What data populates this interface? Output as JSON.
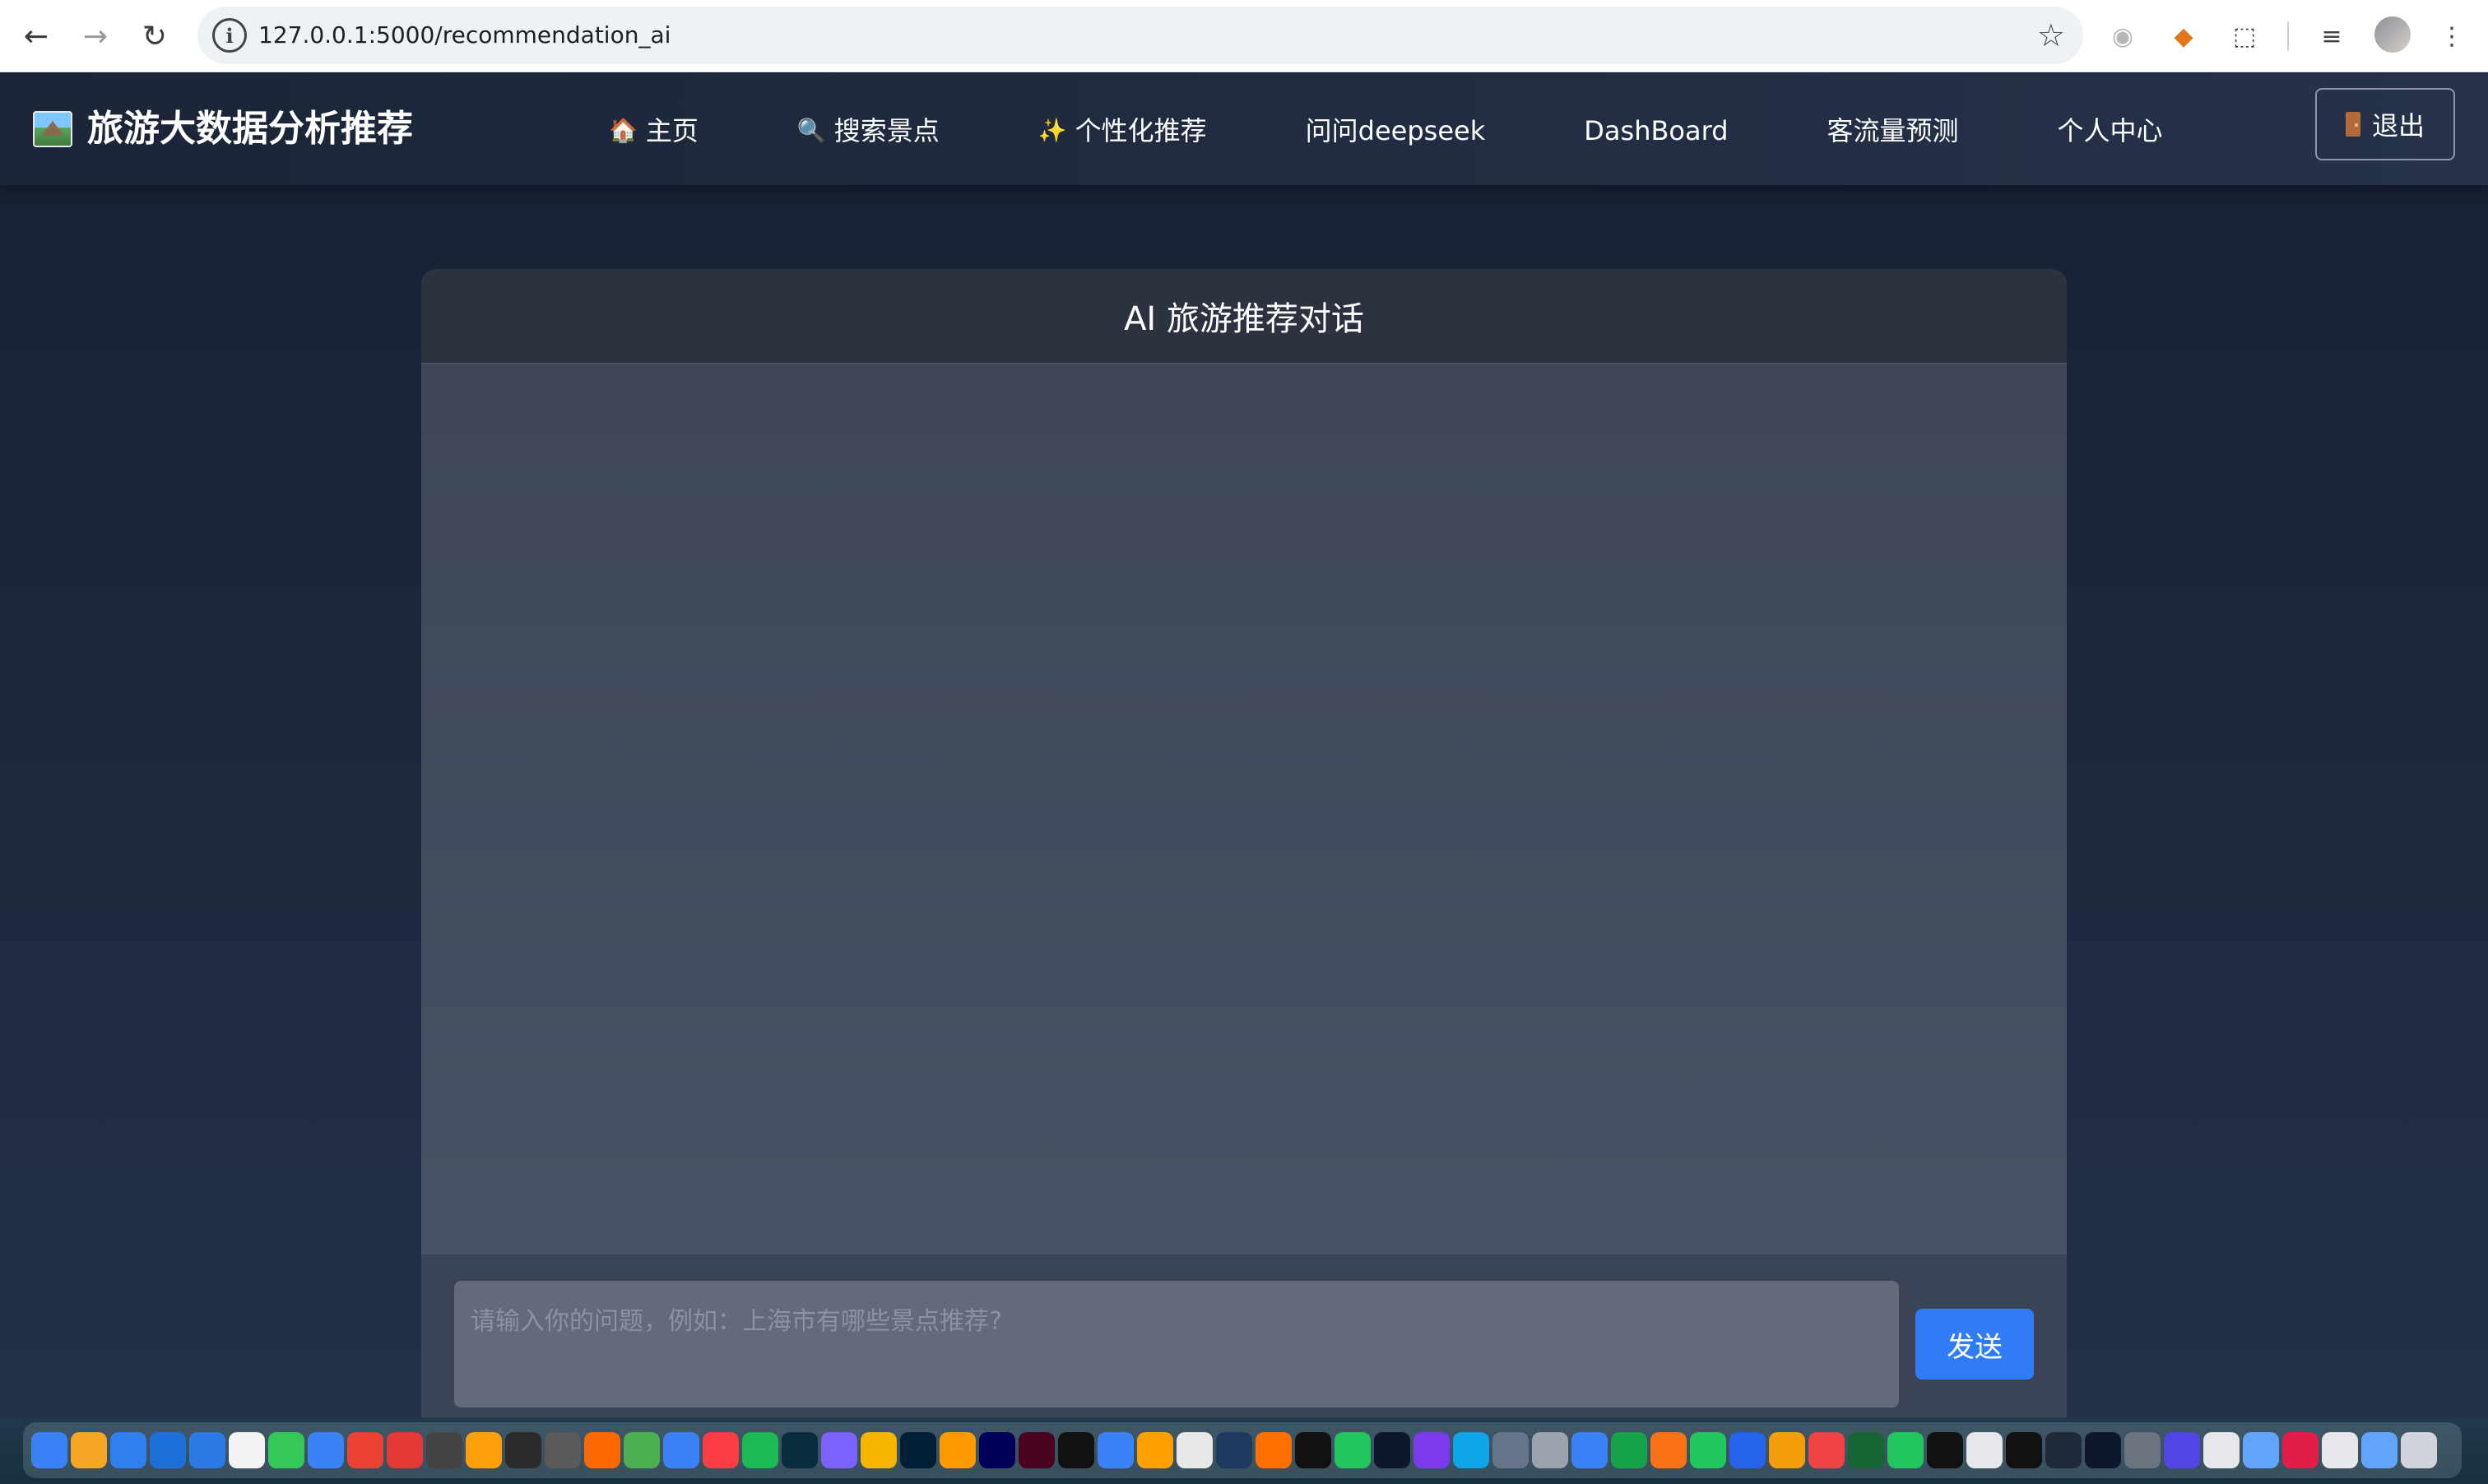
{
  "browser": {
    "url": "127.0.0.1:5000/recommendation_ai",
    "back_icon": "←",
    "forward_icon": "→",
    "reload_icon": "↻",
    "info_icon": "i",
    "star_icon": "☆"
  },
  "navbar": {
    "brand": "旅游大数据分析推荐",
    "items": [
      {
        "icon": "🏠",
        "label": "主页"
      },
      {
        "icon": "🔍",
        "label": "搜索景点"
      },
      {
        "icon": "✨",
        "label": "个性化推荐"
      },
      {
        "icon": "",
        "label": "问问deepseek"
      },
      {
        "icon": "",
        "label": "DashBoard"
      },
      {
        "icon": "",
        "label": "客流量预测"
      },
      {
        "icon": "",
        "label": "个人中心"
      }
    ],
    "logout_label": "退出"
  },
  "chat": {
    "title": "AI 旅游推荐对话",
    "input_placeholder": "请输入你的问题，例如：上海市有哪些景点推荐?",
    "input_value": "",
    "send_label": "发送"
  },
  "dock": {
    "app_colors": [
      "#3b82f6",
      "#f5a623",
      "#2f80ed",
      "#1e6fd9",
      "#2c7be5",
      "#f3f3f3",
      "#34c759",
      "#3b82f6",
      "#ea4335",
      "#e53935",
      "#444444",
      "#ff9f0a",
      "#2b2b2b",
      "#5a5a5a",
      "#ff6a00",
      "#4caf50",
      "#3b82f6",
      "#fc3c44",
      "#1db954",
      "#0a2b3d",
      "#7b61ff",
      "#f7b500",
      "#001e36",
      "#ff9a00",
      "#00005b",
      "#49021f",
      "#111111",
      "#3b82f6",
      "#ffa000",
      "#e8e8e8",
      "#1e3a5f",
      "#ff6f00",
      "#111111",
      "#22c55e",
      "#0f172a",
      "#7c3aed",
      "#0ea5e9",
      "#64748b",
      "#9ca3af",
      "#3b82f6",
      "#16a34a",
      "#f97316",
      "#22c55e",
      "#2563eb",
      "#f59e0b",
      "#ef4444",
      "#166534",
      "#22c55e",
      "#111111",
      "#e5e7eb",
      "#111111",
      "#1f2937",
      "#0f172a",
      "#6b7280",
      "#4f46e5",
      "#e5e7eb",
      "#60a5fa",
      "#e11d48",
      "#e5e7eb",
      "#60a5fa",
      "#d1d5db"
    ]
  }
}
